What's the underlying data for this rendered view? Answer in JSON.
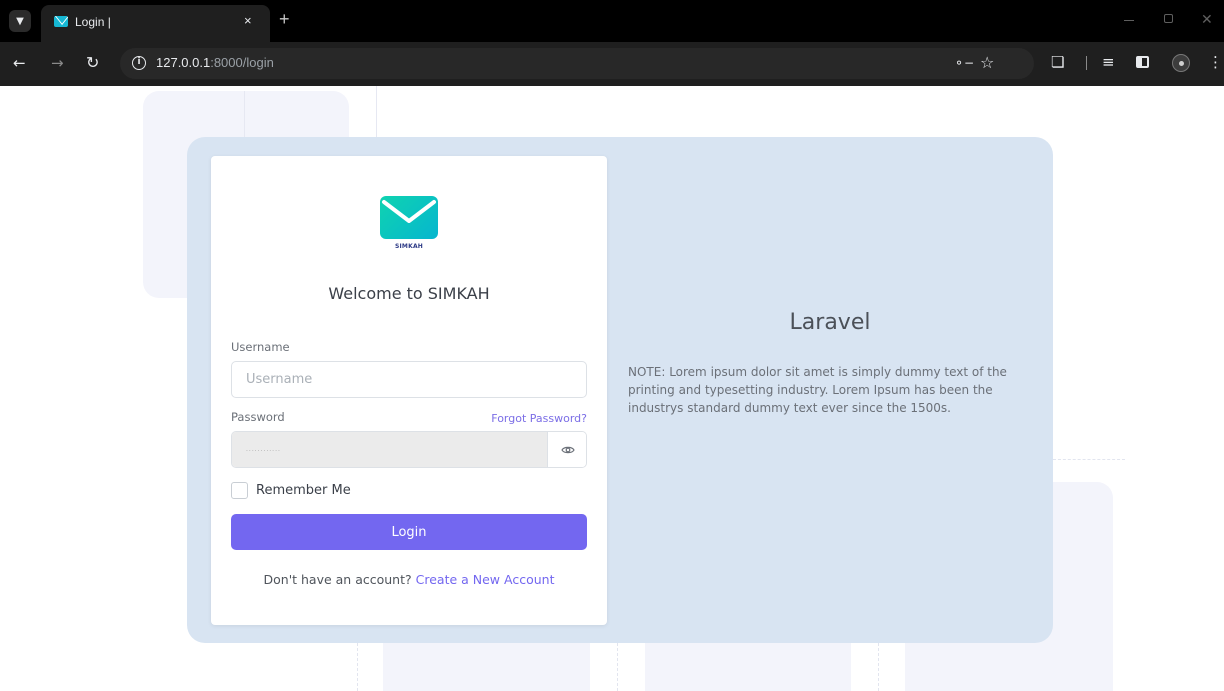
{
  "browser": {
    "tab_title": "Login |",
    "tab_close": "×",
    "new_tab": "+",
    "url_host": "127.0.0.1",
    "url_rest": ":8000/login"
  },
  "login": {
    "logo_text": "SIMKAH",
    "welcome": "Welcome to SIMKAH",
    "username_label": "Username",
    "username_placeholder": "Username",
    "username_value": "",
    "password_label": "Password",
    "password_value": "............",
    "forgot_password": "Forgot Password?",
    "remember_me": "Remember Me",
    "remember_checked": false,
    "login_button": "Login",
    "signup_prompt": "Don't have an account?",
    "signup_link": "Create a New Account"
  },
  "side": {
    "title": "Laravel",
    "note": "NOTE: Lorem ipsum dolor sit amet is simply dummy text of the printing and typesetting industry. Lorem Ipsum has been the industrys standard dummy text ever since the 1500s."
  },
  "colors": {
    "primary": "#7367f0",
    "panel_bg": "#d8e4f2",
    "logo_gradient_start": "#0fd3b0",
    "logo_gradient_end": "#06b6cf"
  },
  "icons": {
    "tab_menu": "chevron-down-icon",
    "favicon": "envelope-icon",
    "back": "arrow-left-icon",
    "forward": "arrow-right-icon",
    "reload": "reload-icon",
    "site_info": "info-icon",
    "password_manager": "key-icon",
    "bookmark": "star-icon",
    "extensions": "puzzle-icon",
    "reading_list": "queue-icon",
    "side_panel": "side-panel-icon",
    "profile": "profile-icon",
    "menu": "more-vert-icon",
    "toggle_password": "eye-icon"
  }
}
